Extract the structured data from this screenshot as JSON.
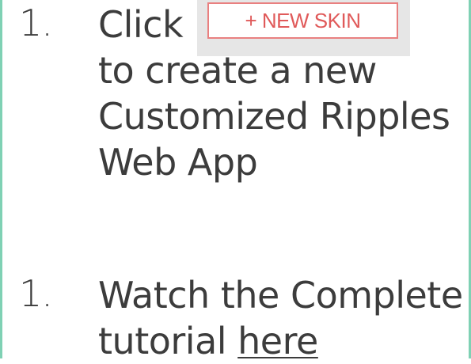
{
  "step1": {
    "number": "1.",
    "click_word": "Click",
    "button_label": "+ NEW SKIN",
    "lines": [
      "to create a new",
      "Customized Ripples",
      "Web App"
    ]
  },
  "step2": {
    "number": "1.",
    "line1": "Watch the Complete",
    "line2_prefix": "tutorial ",
    "link_text": "here"
  },
  "colors": {
    "border_accent": "#7fd1b4",
    "button_text": "#e05a5a",
    "button_border": "#e98080",
    "text": "#3c3c3c"
  }
}
